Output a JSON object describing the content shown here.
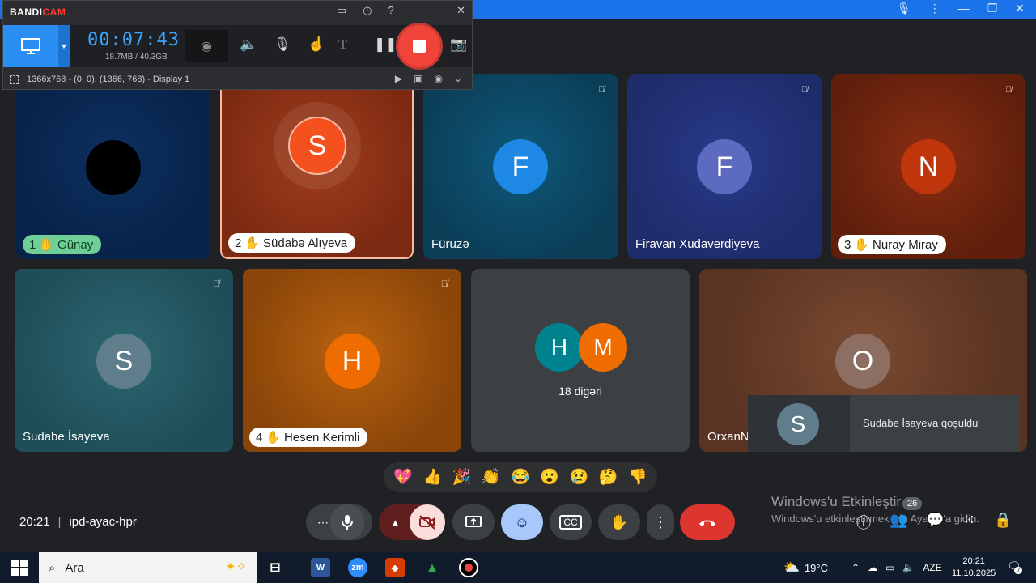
{
  "bandicam": {
    "logo_bandi": "BANDI",
    "logo_cam": "CAM",
    "timer": "00:07:43",
    "size": "18.7MB / 40.3GB",
    "region": "1366x768 - (0, 0), (1366, 768) - Display 1"
  },
  "tiles": [
    {
      "name": "Günay",
      "hand": "1",
      "avatar": ""
    },
    {
      "name": "Südabə Alıyeva",
      "hand": "2",
      "avatar": "S"
    },
    {
      "name": "Füruzə",
      "avatar": "F"
    },
    {
      "name": "Firavan Xudaverdiyeva",
      "avatar": "F"
    },
    {
      "name": "Nuray Miray",
      "hand": "3",
      "avatar": "N"
    },
    {
      "name": "Sudabe İsayeva",
      "avatar": "S"
    },
    {
      "name": "Hesen Kerimli",
      "hand": "4",
      "avatar": "H"
    },
    {
      "others_label": "18 digəri",
      "avatar_a": "H",
      "avatar_b": "M"
    },
    {
      "name": "OrxanN",
      "avatar": "O"
    }
  ],
  "toast": {
    "avatar": "S",
    "text": "Sudabe İsayeva qoşuldu"
  },
  "reactions": [
    "💖",
    "👍",
    "🎉",
    "👏",
    "😂",
    "😮",
    "😢",
    "🤔",
    "👎"
  ],
  "meeting": {
    "time": "20:21",
    "code": "ipd-ayac-hpr"
  },
  "participants_badge": "26",
  "watermark": {
    "line1": "Windows'u Etkinleştir",
    "line2": "Windows'u etkinleştirmek için Ayarlar'a gidin."
  },
  "taskbar": {
    "search_placeholder": "Ara",
    "weather": "19°C",
    "lang": "AZE",
    "time": "20:21",
    "date": "11.10.2025",
    "notif_count": "7"
  },
  "colors": {
    "accent": "#1a73e8",
    "leave": "#dc362e",
    "record": "#f0433a",
    "timer": "#3ba4ff"
  }
}
